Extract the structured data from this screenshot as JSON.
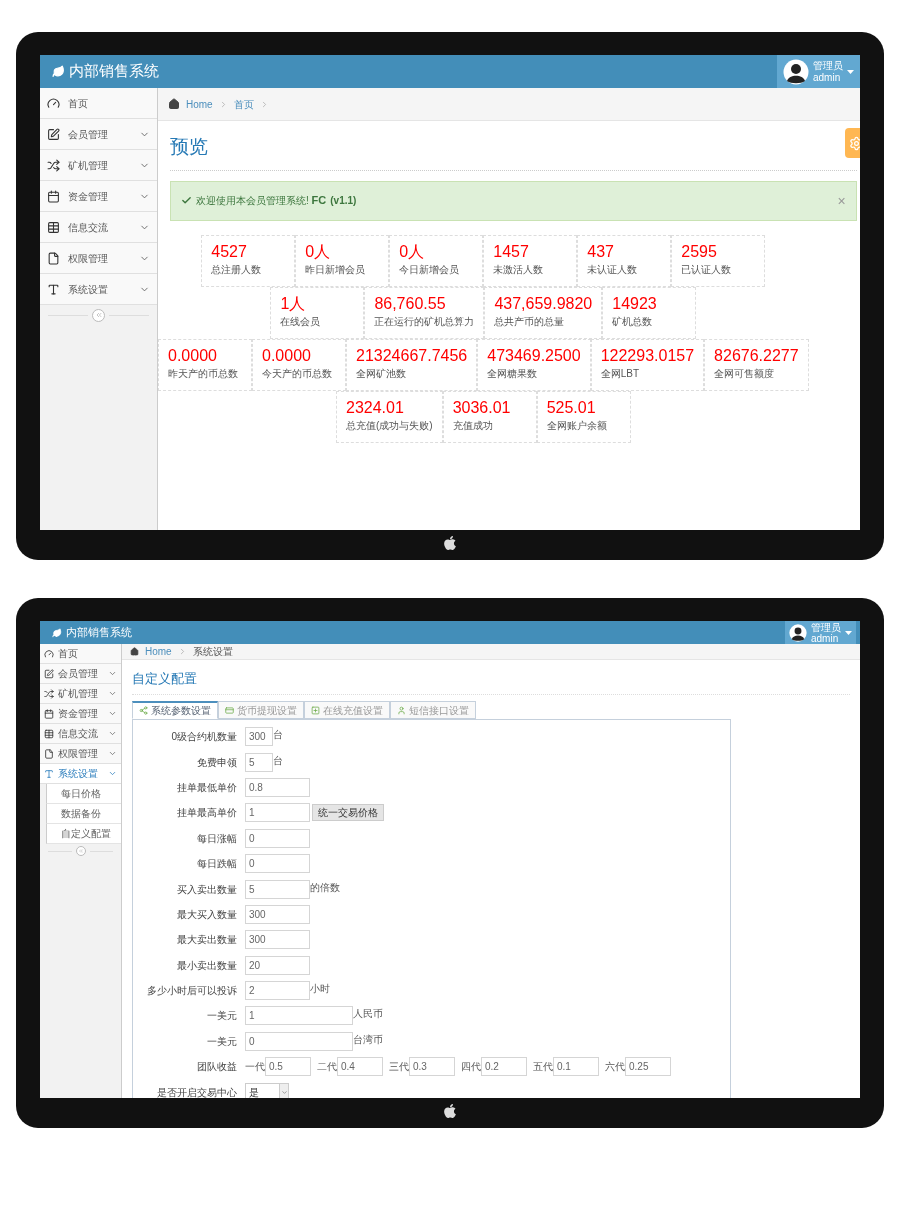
{
  "dashboard": {
    "header": {
      "brand": "内部销售系统",
      "user": {
        "role": "管理员",
        "name": "admin"
      }
    },
    "sidebar": {
      "items": [
        {
          "label": "首页",
          "kind": "link",
          "selected": false
        },
        {
          "label": "会员管理",
          "kind": "menu",
          "selected": false,
          "expanded": false
        },
        {
          "label": "矿机管理",
          "kind": "menu",
          "selected": false,
          "expanded": false
        },
        {
          "label": "资金管理",
          "kind": "menu",
          "selected": false,
          "expanded": false
        },
        {
          "label": "信息交流",
          "kind": "menu",
          "selected": false,
          "expanded": false
        },
        {
          "label": "权限管理",
          "kind": "menu",
          "selected": false,
          "expanded": false
        },
        {
          "label": "系统设置",
          "kind": "menu",
          "selected": false,
          "expanded": false
        }
      ]
    },
    "breadcrumb": {
      "items": [
        "Home",
        "首页"
      ],
      "trailing_separator": true
    },
    "title": "预览",
    "alert": {
      "text": "欢迎使用本会员管理系统! **FC**",
      "version": "(v1.1)",
      "close": "×"
    },
    "stats": [
      [
        {
          "value": "4527",
          "label": "总注册人数"
        },
        {
          "value": "0人",
          "label": "昨日新增会员"
        },
        {
          "value": "0人",
          "label": "今日新增会员"
        },
        {
          "value": "1457",
          "label": "未激活人数"
        },
        {
          "value": "437",
          "label": "未认证人数"
        },
        {
          "value": "2595",
          "label": "已认证人数"
        }
      ],
      [
        {
          "value": "1人",
          "label": "在线会员"
        },
        {
          "value": "86,760.55",
          "label": "正在运行的矿机总算力"
        },
        {
          "value": "437,659.9820",
          "label": "总共产币的总量"
        },
        {
          "value": "14923",
          "label": "矿机总数"
        }
      ],
      [
        {
          "value": "0.0000",
          "label": "昨天产的币总数"
        },
        {
          "value": "0.0000",
          "label": "今天产的币总数"
        },
        {
          "value": "21324667.7456",
          "label": "全网矿池数"
        },
        {
          "value": "473469.2500",
          "label": "全网糖果数"
        },
        {
          "value": "122293.0157",
          "label": "全网LBT"
        },
        {
          "value": "82676.2277",
          "label": "全网可售额度"
        }
      ],
      [
        {
          "value": "2324.01",
          "label": "总充值(成功与失败)"
        },
        {
          "value": "3036.01",
          "label": "充值成功"
        },
        {
          "value": "525.01",
          "label": "全网账户余额"
        }
      ]
    ]
  },
  "settings": {
    "header": {
      "brand": "内部销售系统",
      "user": {
        "role": "管理员",
        "name": "admin"
      }
    },
    "sidebar": {
      "items": [
        {
          "label": "首页",
          "kind": "link",
          "selected": false
        },
        {
          "label": "会员管理",
          "kind": "menu",
          "selected": false,
          "expanded": false
        },
        {
          "label": "矿机管理",
          "kind": "menu",
          "selected": false,
          "expanded": false
        },
        {
          "label": "资金管理",
          "kind": "menu",
          "selected": false,
          "expanded": false
        },
        {
          "label": "信息交流",
          "kind": "menu",
          "selected": false,
          "expanded": false
        },
        {
          "label": "权限管理",
          "kind": "menu",
          "selected": false,
          "expanded": false
        },
        {
          "label": "系统设置",
          "kind": "menu",
          "selected": true,
          "expanded": true,
          "children": [
            {
              "label": "每日价格",
              "selected": false
            },
            {
              "label": "数据备份",
              "selected": false
            },
            {
              "label": "自定义配置",
              "selected": false
            }
          ]
        }
      ]
    },
    "breadcrumb": {
      "items": [
        "Home",
        "系统设置"
      ],
      "trailing_separator": false
    },
    "title": "自定义配置",
    "tabs": [
      {
        "label": "系统参数设置",
        "selected": true
      },
      {
        "label": "货币提现设置",
        "selected": false
      },
      {
        "label": "在线充值设置",
        "selected": false
      },
      {
        "label": "短信接口设置",
        "selected": false
      }
    ],
    "fields": [
      {
        "kind": "short_input",
        "label": "0级合约机数量",
        "value": "300",
        "unit": "台"
      },
      {
        "kind": "short_input",
        "label": "免费申领",
        "value": "5",
        "unit": "台"
      },
      {
        "kind": "input",
        "label": "挂单最低单价",
        "value": "0.8"
      },
      {
        "kind": "input_button",
        "label": "挂单最高单价",
        "value": "1",
        "button": "统一交易价格"
      },
      {
        "kind": "input",
        "label": "每日涨幅",
        "value": "0"
      },
      {
        "kind": "input",
        "label": "每日跌幅",
        "value": "0"
      },
      {
        "kind": "input",
        "label": "买入卖出数量",
        "value": "5",
        "unit": "的倍数"
      },
      {
        "kind": "input",
        "label": "最大买入数量",
        "value": "300"
      },
      {
        "kind": "input",
        "label": "最大卖出数量",
        "value": "300"
      },
      {
        "kind": "input",
        "label": "最小卖出数量",
        "value": "20"
      },
      {
        "kind": "input",
        "label": "多少小时后可以投诉",
        "value": "2",
        "unit": "小时"
      },
      {
        "kind": "long_input",
        "label": "一美元",
        "value": "1",
        "unit": "人民币"
      },
      {
        "kind": "long_input",
        "label": "一美元",
        "value": "0",
        "unit": "台湾币"
      },
      {
        "kind": "group",
        "label": "团队收益",
        "items": [
          {
            "prefix": "一代",
            "value": "0.5"
          },
          {
            "prefix": "二代",
            "value": "0.4"
          },
          {
            "prefix": "三代",
            "value": "0.3"
          },
          {
            "prefix": "四代",
            "value": "0.2"
          },
          {
            "prefix": "五代",
            "value": "0.1"
          },
          {
            "prefix": "六代",
            "value": "0.25"
          }
        ]
      },
      {
        "kind": "select",
        "label": "是否开启交易中心",
        "value": "是"
      }
    ]
  }
}
